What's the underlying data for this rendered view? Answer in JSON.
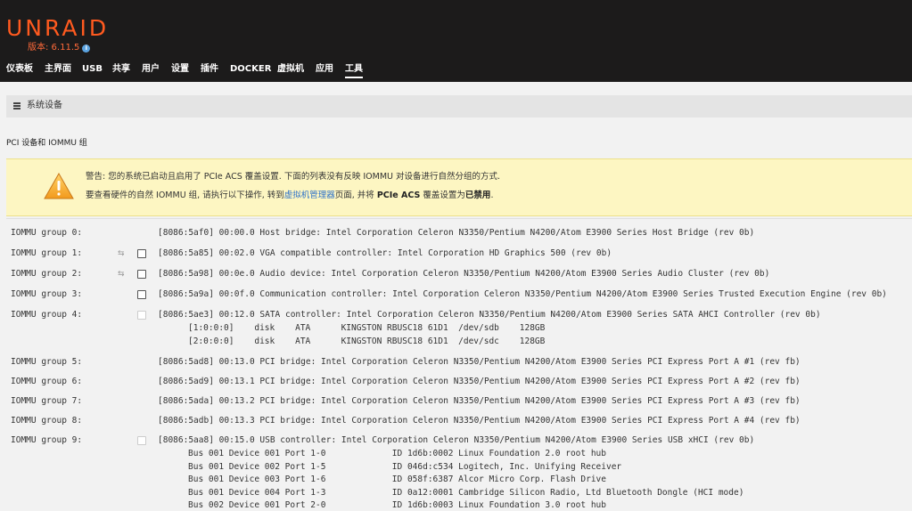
{
  "header": {
    "logo": "UNRAID",
    "version_label": "版本: 6.11.5",
    "info_icon": "info-circle-icon",
    "nav": [
      "仪表板",
      "主界面",
      "USB",
      "共享",
      "用户",
      "设置",
      "插件",
      "DOCKER",
      "虚拟机",
      "应用",
      "工具"
    ],
    "active_nav": "工具"
  },
  "section": {
    "icon": "list-icon",
    "title": "系统设备",
    "subtitle": "PCI 设备和 IOMMU 组"
  },
  "warning": {
    "icon": "warning-triangle-icon",
    "line1": "警告: 您的系统已启动且启用了 PCIe ACS 覆盖设置. 下面的列表没有反映 IOMMU 对设备进行自然分组的方式.",
    "line2_a": "要查看硬件的自然 IOMMU 组, 请执行以下操作, 转到",
    "line2_link": "虚拟机管理器",
    "line2_b": "页面, 并将 ",
    "line2_bold1": "PCIe ACS",
    "line2_c": " 覆盖设置为",
    "line2_bold2": "已禁用",
    "line2_d": "."
  },
  "groups": [
    {
      "label": "IOMMU group 0:",
      "device": "[8086:5af0] 00:00.0 Host bridge: Intel Corporation Celeron N3350/Pentium N4200/Atom E3900 Series Host Bridge (rev 0b)",
      "reset": false,
      "checkbox": "none",
      "sub": []
    },
    {
      "label": "IOMMU group 1:",
      "device": "[8086:5a85] 00:02.0 VGA compatible controller: Intel Corporation HD Graphics 500 (rev 0b)",
      "reset": true,
      "checkbox": "enabled",
      "sub": []
    },
    {
      "label": "IOMMU group 2:",
      "device": "[8086:5a98] 00:0e.0 Audio device: Intel Corporation Celeron N3350/Pentium N4200/Atom E3900 Series Audio Cluster (rev 0b)",
      "reset": true,
      "checkbox": "enabled",
      "sub": []
    },
    {
      "label": "IOMMU group 3:",
      "device": "[8086:5a9a] 00:0f.0 Communication controller: Intel Corporation Celeron N3350/Pentium N4200/Atom E3900 Series Trusted Execution Engine (rev 0b)",
      "reset": false,
      "checkbox": "enabled",
      "sub": []
    },
    {
      "label": "IOMMU group 4:",
      "device": "[8086:5ae3] 00:12.0 SATA controller: Intel Corporation Celeron N3350/Pentium N4200/Atom E3900 Series SATA AHCI Controller (rev 0b)",
      "reset": false,
      "checkbox": "disabled",
      "sub": [
        "[1:0:0:0]    disk    ATA      KINGSTON RBUSC18 61D1  /dev/sdb    128GB",
        "[2:0:0:0]    disk    ATA      KINGSTON RBUSC18 61D1  /dev/sdc    128GB"
      ]
    },
    {
      "label": "IOMMU group 5:",
      "device": "[8086:5ad8] 00:13.0 PCI bridge: Intel Corporation Celeron N3350/Pentium N4200/Atom E3900 Series PCI Express Port A #1 (rev fb)",
      "reset": false,
      "checkbox": "none",
      "sub": []
    },
    {
      "label": "IOMMU group 6:",
      "device": "[8086:5ad9] 00:13.1 PCI bridge: Intel Corporation Celeron N3350/Pentium N4200/Atom E3900 Series PCI Express Port A #2 (rev fb)",
      "reset": false,
      "checkbox": "none",
      "sub": []
    },
    {
      "label": "IOMMU group 7:",
      "device": "[8086:5ada] 00:13.2 PCI bridge: Intel Corporation Celeron N3350/Pentium N4200/Atom E3900 Series PCI Express Port A #3 (rev fb)",
      "reset": false,
      "checkbox": "none",
      "sub": []
    },
    {
      "label": "IOMMU group 8:",
      "device": "[8086:5adb] 00:13.3 PCI bridge: Intel Corporation Celeron N3350/Pentium N4200/Atom E3900 Series PCI Express Port A #4 (rev fb)",
      "reset": false,
      "checkbox": "none",
      "sub": []
    },
    {
      "label": "IOMMU group 9:",
      "device": "[8086:5aa8] 00:15.0 USB controller: Intel Corporation Celeron N3350/Pentium N4200/Atom E3900 Series USB xHCI (rev 0b)",
      "reset": false,
      "checkbox": "disabled",
      "sub": [
        "Bus 001 Device 001 Port 1-0             ID 1d6b:0002 Linux Foundation 2.0 root hub",
        "Bus 001 Device 002 Port 1-5             ID 046d:c534 Logitech, Inc. Unifying Receiver",
        "Bus 001 Device 003 Port 1-6             ID 058f:6387 Alcor Micro Corp. Flash Drive",
        "Bus 001 Device 004 Port 1-3             ID 0a12:0001 Cambridge Silicon Radio, Ltd Bluetooth Dongle (HCI mode)",
        "Bus 002 Device 001 Port 2-0             ID 1d6b:0003 Linux Foundation 3.0 root hub"
      ]
    }
  ]
}
